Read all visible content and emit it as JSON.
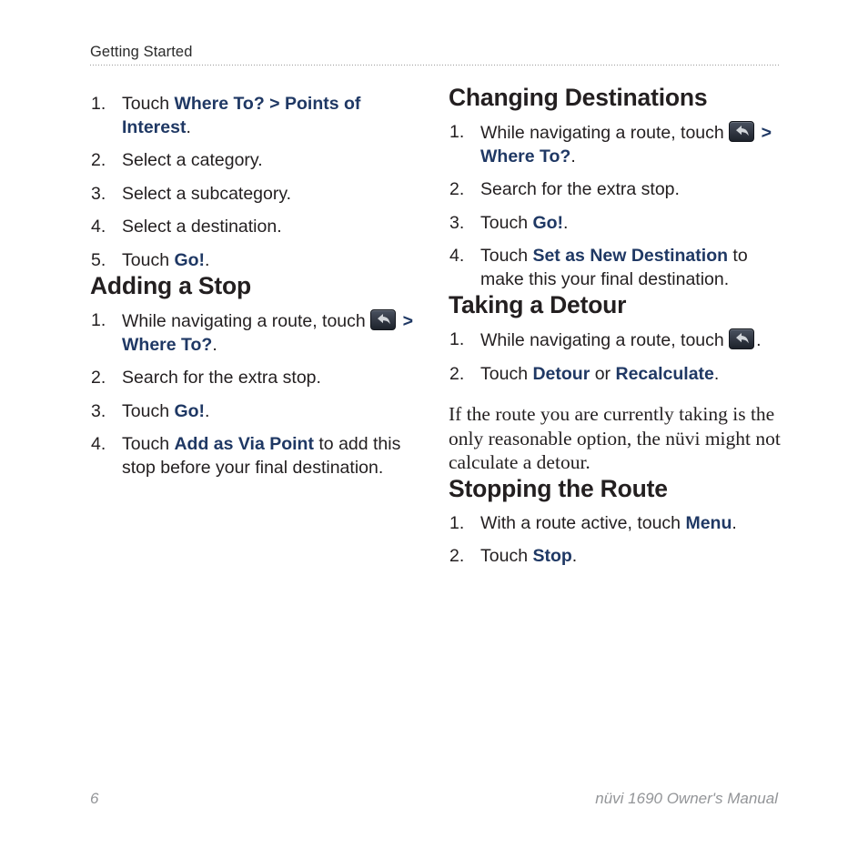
{
  "page": {
    "running_head": "Getting Started",
    "folio": "6",
    "colophon": "nüvi 1690 Owner's Manual",
    "link_color": "#1f3864",
    "text_color": "#231f20",
    "footer_color": "#939598"
  },
  "icons": {
    "back_arrow": "back-arrow-icon"
  },
  "left_column": {
    "list_a": {
      "items": [
        {
          "num": "1.",
          "parts": [
            {
              "t": "Touch ",
              "s": "plain"
            },
            {
              "t": "Where To?",
              "s": "ui"
            },
            {
              "t": " > ",
              "s": "gt"
            },
            {
              "t": "Points of Interest",
              "s": "ui"
            },
            {
              "t": ".",
              "s": "plain"
            }
          ]
        },
        {
          "num": "2.",
          "parts": [
            {
              "t": "Select a category.",
              "s": "plain"
            }
          ]
        },
        {
          "num": "3.",
          "parts": [
            {
              "t": "Select a subcategory.",
              "s": "plain"
            }
          ]
        },
        {
          "num": "4.",
          "parts": [
            {
              "t": "Select a destination.",
              "s": "plain"
            }
          ]
        },
        {
          "num": "5.",
          "parts": [
            {
              "t": "Touch ",
              "s": "plain"
            },
            {
              "t": "Go!",
              "s": "ui"
            },
            {
              "t": ".",
              "s": "plain"
            }
          ]
        }
      ]
    },
    "section": {
      "title": "Adding a Stop",
      "items": [
        {
          "num": "1.",
          "parts": [
            {
              "t": "While navigating a route, touch ",
              "s": "plain"
            },
            {
              "t": "",
              "s": "icon"
            },
            {
              "t": " > ",
              "s": "gt"
            },
            {
              "t": "Where To?",
              "s": "ui"
            },
            {
              "t": ".",
              "s": "plain"
            }
          ]
        },
        {
          "num": "2.",
          "parts": [
            {
              "t": "Search for the extra stop.",
              "s": "plain"
            }
          ]
        },
        {
          "num": "3.",
          "parts": [
            {
              "t": "Touch ",
              "s": "plain"
            },
            {
              "t": "Go!",
              "s": "ui"
            },
            {
              "t": ".",
              "s": "plain"
            }
          ]
        },
        {
          "num": "4.",
          "parts": [
            {
              "t": "Touch ",
              "s": "plain"
            },
            {
              "t": "Add as Via Point",
              "s": "ui"
            },
            {
              "t": " to add this stop before your final destination.",
              "s": "plain"
            }
          ]
        }
      ]
    }
  },
  "right_column": {
    "section_changing": {
      "title": "Changing Destinations",
      "items": [
        {
          "num": "1.",
          "parts": [
            {
              "t": "While navigating a route, touch ",
              "s": "plain"
            },
            {
              "t": "",
              "s": "icon"
            },
            {
              "t": " > ",
              "s": "gt"
            },
            {
              "t": "Where To?",
              "s": "ui"
            },
            {
              "t": ".",
              "s": "plain"
            }
          ]
        },
        {
          "num": "2.",
          "parts": [
            {
              "t": "Search for the extra stop.",
              "s": "plain"
            }
          ]
        },
        {
          "num": "3.",
          "parts": [
            {
              "t": "Touch ",
              "s": "plain"
            },
            {
              "t": "Go!",
              "s": "ui"
            },
            {
              "t": ".",
              "s": "plain"
            }
          ]
        },
        {
          "num": "4.",
          "parts": [
            {
              "t": "Touch ",
              "s": "plain"
            },
            {
              "t": "Set as New Destination",
              "s": "ui"
            },
            {
              "t": " to make this your final destination.",
              "s": "plain"
            }
          ]
        }
      ]
    },
    "section_detour": {
      "title": "Taking a Detour",
      "items": [
        {
          "num": "1.",
          "parts": [
            {
              "t": "While navigating a route, touch ",
              "s": "plain"
            },
            {
              "t": "",
              "s": "icon"
            },
            {
              "t": ".",
              "s": "plain"
            }
          ]
        },
        {
          "num": "2.",
          "parts": [
            {
              "t": "Touch ",
              "s": "plain"
            },
            {
              "t": "Detour",
              "s": "ui"
            },
            {
              "t": " or ",
              "s": "plain"
            },
            {
              "t": "Recalculate",
              "s": "ui"
            },
            {
              "t": ".",
              "s": "plain"
            }
          ]
        }
      ],
      "note": "If the route you are currently taking is the only reasonable option, the nüvi might not calculate a detour."
    },
    "section_stopping": {
      "title": "Stopping the Route",
      "items": [
        {
          "num": "1.",
          "parts": [
            {
              "t": "With a route active, touch ",
              "s": "plain"
            },
            {
              "t": "Menu",
              "s": "ui"
            },
            {
              "t": ".",
              "s": "plain"
            }
          ]
        },
        {
          "num": "2.",
          "parts": [
            {
              "t": "Touch ",
              "s": "plain"
            },
            {
              "t": "Stop",
              "s": "ui"
            },
            {
              "t": ".",
              "s": "plain"
            }
          ]
        }
      ]
    }
  }
}
